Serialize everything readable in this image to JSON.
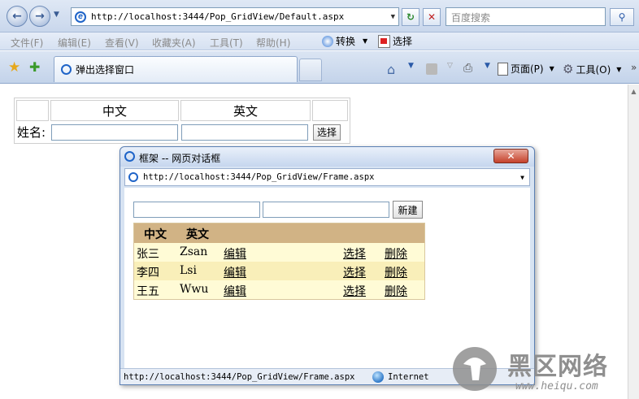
{
  "browser": {
    "address": "http://localhost:3444/Pop_GridView/Default.aspx",
    "search_placeholder": "百度搜索",
    "menu": [
      "文件(F)",
      "编辑(E)",
      "查看(V)",
      "收藏夹(A)",
      "工具(T)",
      "帮助(H)"
    ],
    "convert_label": "转换",
    "select_label": "选择",
    "tab_title": "弹出选择窗口",
    "page_menu": "页面(P)",
    "tools_menu": "工具(O)"
  },
  "page": {
    "headers": [
      "中文",
      "英文"
    ],
    "name_label": "姓名:",
    "select_button": "选择"
  },
  "dialog": {
    "title": "框架 -- 网页对话框",
    "address": "http://localhost:3444/Pop_GridView/Frame.aspx",
    "new_button": "新建",
    "grid_headers": [
      "中文",
      "英文"
    ],
    "rows": [
      {
        "zh": "张三",
        "en": "Zsan",
        "edit": "编辑",
        "select": "选择",
        "delete": "删除"
      },
      {
        "zh": "李四",
        "en": "Lsi",
        "edit": "编辑",
        "select": "选择",
        "delete": "删除"
      },
      {
        "zh": "王五",
        "en": "Wwu",
        "edit": "编辑",
        "select": "选择",
        "delete": "删除"
      }
    ],
    "status_url": "http://localhost:3444/Pop_GridView/Frame.aspx",
    "status_zone": "Internet"
  },
  "watermark": {
    "brand": "黑区网络",
    "url": "www.heiqu.com"
  }
}
